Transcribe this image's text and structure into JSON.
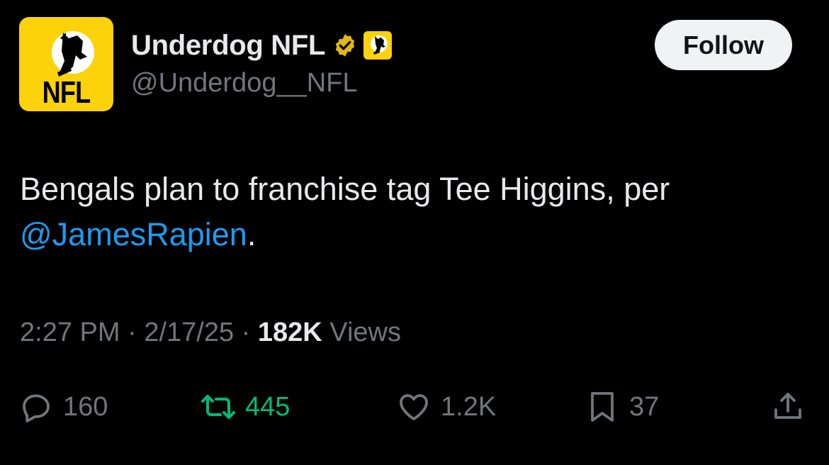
{
  "account": {
    "display_name": "Underdog NFL",
    "handle": "@Underdog__NFL",
    "avatar_text": "NFL",
    "verified": true,
    "brand_color": "#fcd20a"
  },
  "follow_button": {
    "label": "Follow"
  },
  "tweet": {
    "text_before_mention": "Bengals plan to franchise tag Tee Higgins, per ",
    "mention": "@JamesRapien",
    "text_after_mention": "."
  },
  "meta": {
    "time": "2:27 PM",
    "separator": " · ",
    "date": "2/17/25",
    "views_count": "182K",
    "views_label": " Views"
  },
  "actions": {
    "replies": {
      "icon": "reply-icon",
      "count": "160"
    },
    "retweets": {
      "icon": "retweet-icon",
      "count": "445",
      "color": "#00ba7c"
    },
    "likes": {
      "icon": "heart-icon",
      "count": "1.2K"
    },
    "bookmarks": {
      "icon": "bookmark-icon",
      "count": "37"
    },
    "share": {
      "icon": "share-icon"
    }
  },
  "colors": {
    "background": "#000000",
    "text_primary": "#e7e9ea",
    "text_secondary": "#71767b",
    "link": "#1d9bf0",
    "verified_gold": "#e2b719"
  }
}
